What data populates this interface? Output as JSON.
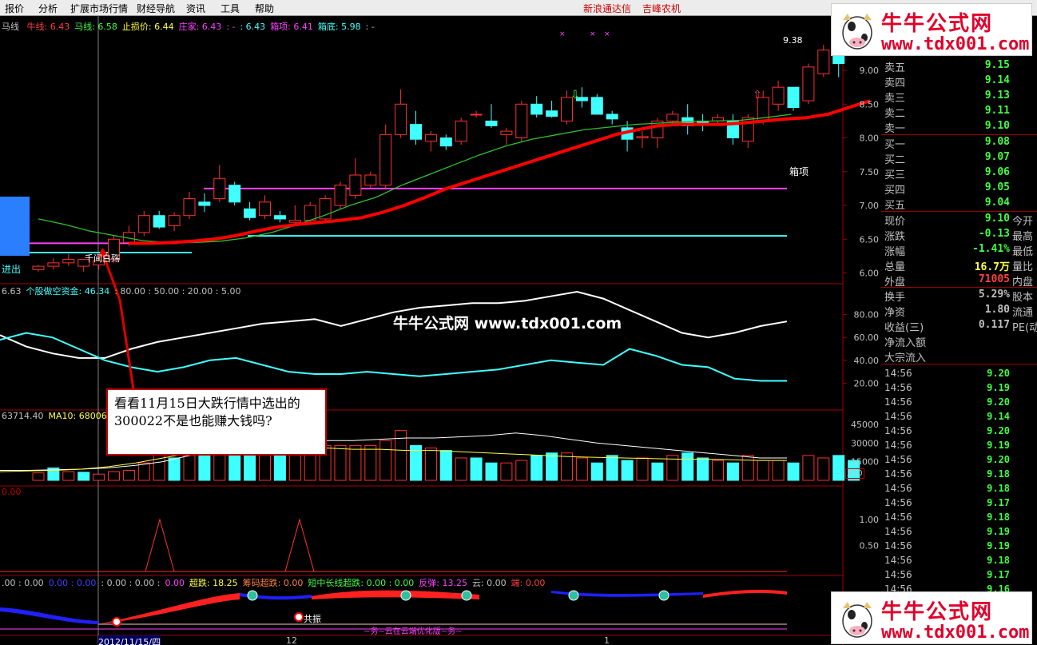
{
  "menu": {
    "items": [
      "报价",
      "分析",
      "扩展市场行情",
      "财经导航",
      "资讯",
      "工具",
      "帮助"
    ],
    "stock_links": [
      "新浪通达信",
      "吉峰农机"
    ]
  },
  "main_header": {
    "name": "马线",
    "items": [
      {
        "label": "牛线: 6.43",
        "color": "#ff4040"
      },
      {
        "label": "马线: 6.58",
        "color": "#40ff40"
      },
      {
        "label": "止损价: 6.44",
        "color": "#ffff40"
      },
      {
        "label": "庄家: 6.43",
        "color": "#ff40ff"
      },
      {
        "label": ": -",
        "color": "#ff40ff"
      },
      {
        "label": ": 6.43",
        "color": "#40ffff"
      },
      {
        "label": "箱项: 6.41",
        "color": "#ff40ff"
      },
      {
        "label": "箱底: 5.98",
        "color": "#40ffff"
      },
      {
        "label": ": -",
        "color": "#c0c0c0"
      }
    ]
  },
  "main_axis": [
    "9.00",
    "8.50",
    "8.00",
    "7.50",
    "7.00",
    "6.50",
    "6.00"
  ],
  "high_label": "9.38",
  "box_top_label": "箱项",
  "buy_in_label": "进出",
  "cross_label": "千间白殇",
  "ind1": {
    "header": [
      {
        "label": "6.63",
        "color": "#c0c0c0"
      },
      {
        "label": "个股做空资金: 46.34",
        "color": "#40ffff"
      },
      {
        "label": ": 80.00 : 50.00 : 20.00 : 5.00",
        "color": "#c0c0c0"
      }
    ],
    "axis": [
      "80.00",
      "60.00",
      "40.00",
      "20.00"
    ]
  },
  "vol": {
    "header": [
      {
        "label": "63714.40",
        "color": "#c0c0c0"
      },
      {
        "label": "MA10: 68006.5",
        "color": "#ffff40"
      }
    ],
    "axis": [
      "45000",
      "30000",
      "15000"
    ],
    "unit": "X10"
  },
  "ind3": {
    "header": [
      {
        "label": "0.00",
        "color": "#c00000"
      }
    ],
    "axis": [
      "1.00",
      "0.50"
    ]
  },
  "ind4": {
    "header": [
      {
        "label": ".00 : 0.00",
        "color": "#c0c0c0"
      },
      {
        "label": "0.00 : 0.00",
        "color": "#4040ff"
      },
      {
        "label": ": 0.00 : 0.00 :",
        "color": "#c0c0c0"
      },
      {
        "label": "0.00",
        "color": "#ff40ff"
      },
      {
        "label": "超跌: 18.25",
        "color": "#ffff40"
      },
      {
        "label": "筹码超跌: 0.00",
        "color": "#ff8040"
      },
      {
        "label": "短中长线超跌: 0.00 : 0.00",
        "color": "#40ff40"
      },
      {
        "label": "反弹: 13.25",
        "color": "#ff40ff"
      },
      {
        "label": "云: 0.00",
        "color": "#c0c0c0"
      },
      {
        "label": "端: 0.00",
        "color": "#ff4040"
      }
    ],
    "resonance_label": "共振",
    "bottom_label": "~务~云在云端优化版~务~"
  },
  "dates": [
    "2012/11/15/四",
    "12",
    "1"
  ],
  "watermark": "牛牛公式网 www.tdx001.com",
  "callout": "看看11月15日大跌行情中选出的300022不是也能赚大钱吗?",
  "logo": {
    "title": "牛牛公式网",
    "url": "www.tdx001.com"
  },
  "quote": {
    "asks": [
      {
        "label": "卖五",
        "price": "9.15"
      },
      {
        "label": "卖四",
        "price": "9.14"
      },
      {
        "label": "卖三",
        "price": "9.13"
      },
      {
        "label": "卖二",
        "price": "9.11"
      },
      {
        "label": "卖一",
        "price": "9.10"
      }
    ],
    "bids": [
      {
        "label": "买一",
        "price": "9.08"
      },
      {
        "label": "买二",
        "price": "9.07"
      },
      {
        "label": "买三",
        "price": "9.06"
      },
      {
        "label": "买四",
        "price": "9.05"
      },
      {
        "label": "买五",
        "price": "9.04"
      }
    ],
    "stats": [
      {
        "label": "现价",
        "value": "9.10",
        "color": "#40ff40",
        "extra": "今开"
      },
      {
        "label": "涨跌",
        "value": "-0.13",
        "color": "#40ff40",
        "extra": "最高"
      },
      {
        "label": "涨幅",
        "value": "-1.41%",
        "color": "#40ff40",
        "extra": "最低"
      },
      {
        "label": "总量",
        "value": "16.7万",
        "color": "#ffff40",
        "extra": "量比"
      },
      {
        "label": "外盘",
        "value": "71005",
        "color": "#ff4040",
        "extra": "内盘"
      },
      {
        "label": "换手",
        "value": "5.29%",
        "color": "#c0c0c0",
        "extra": "股本"
      },
      {
        "label": "净资",
        "value": "1.80",
        "color": "#c0c0c0",
        "extra": "流通"
      },
      {
        "label": "收益(三)",
        "value": "0.117",
        "color": "#c0c0c0",
        "extra": "PE(动"
      },
      {
        "label": "净流入额",
        "value": "",
        "color": "#c0c0c0",
        "extra": ""
      },
      {
        "label": "大宗流入",
        "value": "",
        "color": "#c0c0c0",
        "extra": ""
      }
    ],
    "ticks": [
      {
        "time": "14:56",
        "price": "9.20"
      },
      {
        "time": "14:56",
        "price": "9.19"
      },
      {
        "time": "14:56",
        "price": "9.20"
      },
      {
        "time": "14:56",
        "price": "9.14"
      },
      {
        "time": "14:56",
        "price": "9.20"
      },
      {
        "time": "14:56",
        "price": "9.19"
      },
      {
        "time": "14:56",
        "price": "9.20"
      },
      {
        "time": "14:56",
        "price": "9.18"
      },
      {
        "time": "14:56",
        "price": "9.18"
      },
      {
        "time": "14:56",
        "price": "9.17"
      },
      {
        "time": "14:56",
        "price": "9.18"
      },
      {
        "time": "14:56",
        "price": "9.19"
      },
      {
        "time": "14:56",
        "price": "9.19"
      },
      {
        "time": "14:56",
        "price": "9.18"
      },
      {
        "time": "14:56",
        "price": "9.17"
      },
      {
        "time": "14:56",
        "price": "9.16"
      }
    ]
  },
  "chart_data": {
    "type": "candlestick",
    "candles": [
      {
        "o": 6.05,
        "h": 6.12,
        "l": 6.02,
        "c": 6.1
      },
      {
        "o": 6.1,
        "h": 6.22,
        "l": 6.05,
        "c": 6.15
      },
      {
        "o": 6.15,
        "h": 6.28,
        "l": 6.1,
        "c": 6.2
      },
      {
        "o": 6.1,
        "h": 6.18,
        "l": 6.02,
        "c": 6.2
      },
      {
        "o": 6.12,
        "h": 6.25,
        "l": 6.05,
        "c": 6.18
      },
      {
        "o": 6.2,
        "h": 6.55,
        "l": 6.15,
        "c": 6.5
      },
      {
        "o": 6.45,
        "h": 6.7,
        "l": 6.4,
        "c": 6.6
      },
      {
        "o": 6.6,
        "h": 6.92,
        "l": 6.55,
        "c": 6.85
      },
      {
        "o": 6.85,
        "h": 6.92,
        "l": 6.65,
        "c": 6.68
      },
      {
        "o": 6.7,
        "h": 6.9,
        "l": 6.62,
        "c": 6.85
      },
      {
        "o": 6.85,
        "h": 7.2,
        "l": 6.8,
        "c": 7.1
      },
      {
        "o": 7.05,
        "h": 7.18,
        "l": 6.9,
        "c": 7.0
      },
      {
        "o": 7.1,
        "h": 7.6,
        "l": 7.05,
        "c": 7.4
      },
      {
        "o": 7.3,
        "h": 7.35,
        "l": 7.0,
        "c": 7.05
      },
      {
        "o": 6.95,
        "h": 7.05,
        "l": 6.78,
        "c": 6.82
      },
      {
        "o": 6.85,
        "h": 7.15,
        "l": 6.8,
        "c": 7.05
      },
      {
        "o": 6.85,
        "h": 6.92,
        "l": 6.75,
        "c": 6.8
      },
      {
        "o": 6.75,
        "h": 7.0,
        "l": 6.7,
        "c": 6.78
      },
      {
        "o": 6.78,
        "h": 7.05,
        "l": 6.72,
        "c": 7.0
      },
      {
        "o": 6.8,
        "h": 7.15,
        "l": 6.75,
        "c": 7.1
      },
      {
        "o": 7.0,
        "h": 7.35,
        "l": 6.95,
        "c": 7.3
      },
      {
        "o": 7.15,
        "h": 7.7,
        "l": 7.1,
        "c": 7.45
      },
      {
        "o": 7.3,
        "h": 7.5,
        "l": 7.25,
        "c": 7.45
      },
      {
        "o": 7.3,
        "h": 8.2,
        "l": 7.25,
        "c": 8.05
      },
      {
        "o": 8.05,
        "h": 8.72,
        "l": 8.0,
        "c": 8.5
      },
      {
        "o": 8.2,
        "h": 8.4,
        "l": 7.9,
        "c": 7.98
      },
      {
        "o": 7.95,
        "h": 8.1,
        "l": 7.8,
        "c": 8.05
      },
      {
        "o": 8.0,
        "h": 8.05,
        "l": 7.82,
        "c": 7.88
      },
      {
        "o": 7.95,
        "h": 8.3,
        "l": 7.9,
        "c": 8.25
      },
      {
        "o": 8.35,
        "h": 8.4,
        "l": 8.3,
        "c": 8.35
      },
      {
        "o": 8.25,
        "h": 8.5,
        "l": 8.15,
        "c": 8.18
      },
      {
        "o": 8.05,
        "h": 8.15,
        "l": 7.9,
        "c": 8.1
      },
      {
        "o": 8.0,
        "h": 8.55,
        "l": 7.95,
        "c": 8.5
      },
      {
        "o": 8.5,
        "h": 8.62,
        "l": 8.3,
        "c": 8.35
      },
      {
        "o": 8.4,
        "h": 8.55,
        "l": 8.3,
        "c": 8.32
      },
      {
        "o": 8.25,
        "h": 8.7,
        "l": 8.2,
        "c": 8.6
      },
      {
        "o": 8.6,
        "h": 8.75,
        "l": 8.45,
        "c": 8.55
      },
      {
        "o": 8.6,
        "h": 8.65,
        "l": 8.35,
        "c": 8.35
      },
      {
        "o": 8.35,
        "h": 8.4,
        "l": 8.2,
        "c": 8.28
      },
      {
        "o": 8.15,
        "h": 8.25,
        "l": 7.8,
        "c": 7.98
      },
      {
        "o": 8.0,
        "h": 8.1,
        "l": 7.85,
        "c": 8.02
      },
      {
        "o": 8.0,
        "h": 8.3,
        "l": 7.85,
        "c": 8.25
      },
      {
        "o": 8.25,
        "h": 8.4,
        "l": 8.2,
        "c": 8.35
      },
      {
        "o": 8.3,
        "h": 8.5,
        "l": 8.05,
        "c": 8.18
      },
      {
        "o": 8.25,
        "h": 8.35,
        "l": 8.1,
        "c": 8.22
      },
      {
        "o": 8.25,
        "h": 8.35,
        "l": 8.2,
        "c": 8.3
      },
      {
        "o": 8.25,
        "h": 8.35,
        "l": 7.9,
        "c": 8.0
      },
      {
        "o": 7.95,
        "h": 8.35,
        "l": 7.85,
        "c": 8.3
      },
      {
        "o": 8.25,
        "h": 8.7,
        "l": 8.2,
        "c": 8.6
      },
      {
        "o": 8.5,
        "h": 8.85,
        "l": 8.4,
        "c": 8.75
      },
      {
        "o": 8.75,
        "h": 8.75,
        "l": 8.4,
        "c": 8.45
      },
      {
        "o": 8.55,
        "h": 9.1,
        "l": 8.5,
        "c": 9.05
      },
      {
        "o": 8.95,
        "h": 9.38,
        "l": 8.9,
        "c": 9.3
      },
      {
        "o": 9.3,
        "h": 9.38,
        "l": 8.9,
        "c": 9.1
      }
    ],
    "red_line": [
      6.44,
      6.44,
      6.45,
      6.47,
      6.5,
      6.55,
      6.62,
      6.68,
      6.72,
      6.75,
      6.78,
      6.82,
      6.9,
      7.0,
      7.12,
      7.25,
      7.35,
      7.45,
      7.55,
      7.65,
      7.75,
      7.85,
      7.95,
      8.05,
      8.12,
      8.18,
      8.2,
      8.2,
      8.2,
      8.22,
      8.25,
      8.28,
      8.3,
      8.35,
      8.45,
      8.55
    ],
    "green_line": [
      6.8,
      6.72,
      6.62,
      6.55,
      6.48,
      6.45,
      6.45,
      6.47,
      6.52,
      6.6,
      6.72,
      6.85,
      7.0,
      7.12,
      7.3,
      7.45,
      7.6,
      7.75,
      7.88,
      7.98,
      8.05,
      8.12,
      8.16,
      8.2,
      8.22,
      8.24,
      8.25,
      8.26,
      8.3,
      8.35
    ],
    "box_top": 7.25,
    "box_bottom": 6.55,
    "stop_line": 6.44,
    "ind1_white": [
      62,
      52,
      46,
      42,
      42,
      50,
      56,
      60,
      64,
      68,
      72,
      74,
      76,
      70,
      76,
      82,
      86,
      88,
      90,
      90,
      92,
      96,
      100,
      94,
      84,
      74,
      64,
      60,
      64,
      70,
      74
    ],
    "ind1_cyan": [
      58,
      64,
      60,
      50,
      40,
      34,
      30,
      34,
      40,
      42,
      36,
      30,
      28,
      28,
      30,
      28,
      26,
      28,
      30,
      32,
      36,
      40,
      38,
      36,
      50,
      44,
      36,
      34,
      24,
      22,
      22
    ],
    "volume": [
      6000,
      10000,
      7000,
      6500,
      5000,
      7000,
      8000,
      14000,
      25000,
      18000,
      20000,
      24000,
      22000,
      22000,
      24000,
      26000,
      25000,
      25000,
      28000,
      28000,
      28000,
      28000,
      28000,
      32000,
      40000,
      28000,
      26000,
      24000,
      18000,
      18000,
      14000,
      14000,
      16000,
      20000,
      22000,
      22000,
      18000,
      14000,
      20000,
      16000,
      18000,
      14000,
      20000,
      22000,
      18000,
      16000,
      14000,
      20000,
      16000,
      16000,
      14000,
      20000,
      18000,
      20000,
      16000
    ],
    "vol_up": [
      true,
      false,
      true,
      false,
      true,
      true,
      true,
      true,
      true,
      false,
      true,
      false,
      true,
      false,
      false,
      true,
      false,
      true,
      true,
      true,
      true,
      true,
      true,
      true,
      true,
      false,
      true,
      false,
      true,
      false,
      false,
      true,
      true,
      false,
      false,
      true,
      true,
      false,
      false,
      false,
      true,
      false,
      true,
      false,
      false,
      true,
      false,
      true,
      true,
      true,
      false,
      true,
      true,
      false,
      false
    ],
    "ma_vol_white": [
      8000,
      8000,
      8500,
      9000,
      10000,
      12000,
      15000,
      20000,
      24000,
      26000,
      28000,
      30000,
      32000,
      32000,
      33000,
      34000,
      34000,
      35000,
      36000,
      38000,
      36000,
      33000,
      30000,
      28000,
      26000,
      24000,
      22000,
      20000,
      18000,
      18000
    ],
    "ma_vol_yellow": [
      7000,
      7500,
      8000,
      9000,
      11000,
      14000,
      18000,
      22000,
      25000,
      26000,
      26000,
      26000,
      26000,
      25000,
      25000,
      24000,
      24000,
      23000,
      22000,
      21000,
      20000,
      19000,
      18500,
      18000,
      17500,
      17000,
      17000,
      16500,
      16000,
      16000
    ],
    "ind3_spikes": [
      1.0,
      1.0
    ]
  }
}
